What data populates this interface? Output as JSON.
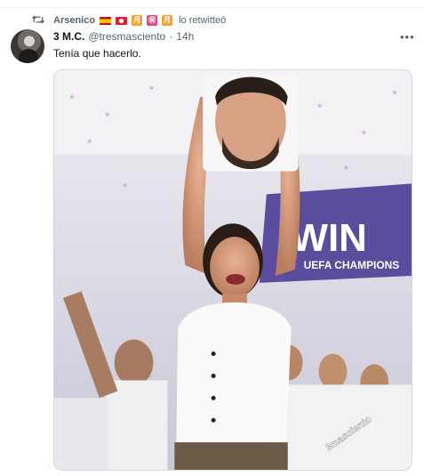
{
  "retweet": {
    "icon": "retweet-icon",
    "name": "Arsenico",
    "emoji_1": "月",
    "emoji_2": "㊗",
    "emoji_3": "月",
    "suffix": "lo retwitteó"
  },
  "tweet": {
    "author": "3 M.C.",
    "handle": "@tresmasciento",
    "separator": "·",
    "time": "14h",
    "text": "Tenía que hacerlo.",
    "more_icon": "more-horizontal-icon",
    "more_label": "•••"
  },
  "media": {
    "banner_text": "WIN",
    "banner_subtext": "UEFA CHAMPIONS",
    "watermark": "3masciento"
  },
  "colors": {
    "text_primary": "#0f1419",
    "text_secondary": "#536471",
    "banner_purple": "#5a4d9e",
    "border": "#cfd9de"
  }
}
